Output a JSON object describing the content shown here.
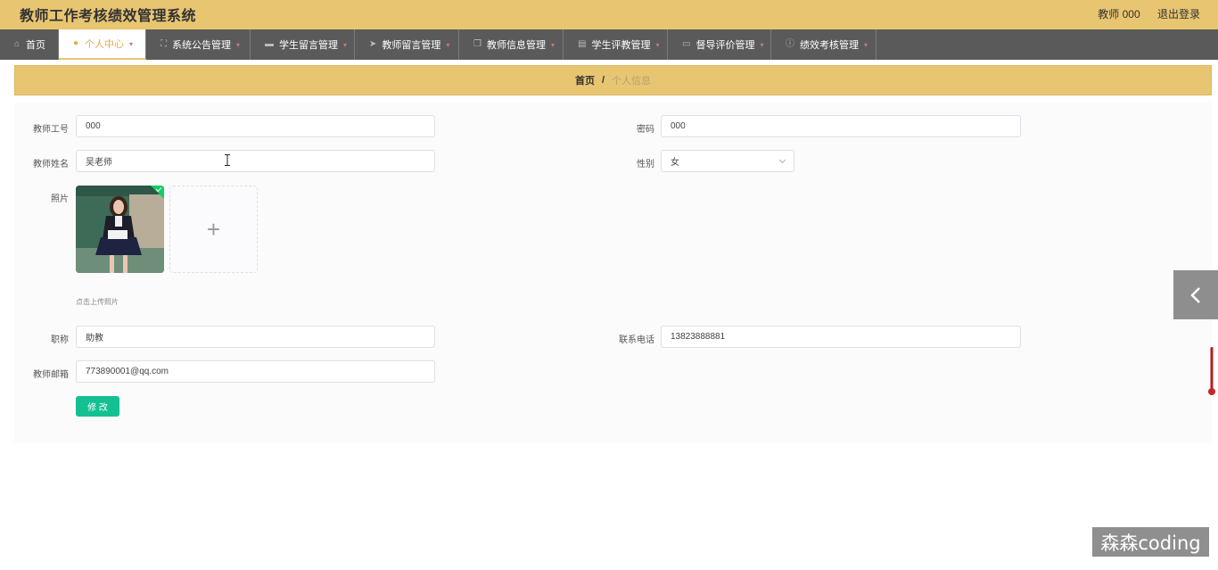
{
  "header": {
    "title": "教师工作考核绩效管理系统",
    "user_label": "教师 000",
    "logout_label": "退出登录"
  },
  "nav": {
    "items": [
      {
        "label": "首页",
        "icon": "home-icon"
      },
      {
        "label": "个人中心",
        "icon": "user-icon"
      },
      {
        "label": "系统公告管理",
        "icon": "expand-icon"
      },
      {
        "label": "学生留言管理",
        "icon": "bag-icon"
      },
      {
        "label": "教师留言管理",
        "icon": "send-icon"
      },
      {
        "label": "教师信息管理",
        "icon": "copy-icon"
      },
      {
        "label": "学生评教管理",
        "icon": "document-icon"
      },
      {
        "label": "督导评价管理",
        "icon": "monitor-icon"
      },
      {
        "label": "绩效考核管理",
        "icon": "info-circle-icon"
      }
    ]
  },
  "breadcrumb": {
    "home": "首页",
    "separator": "/",
    "current": "个人信息"
  },
  "form": {
    "teacher_id_label": "教师工号",
    "teacher_id_value": "000",
    "password_label": "密码",
    "password_value": "000",
    "name_label": "教师姓名",
    "name_value": "吴老师",
    "gender_label": "性别",
    "gender_value": "女",
    "photo_label": "照片",
    "upload_hint": "点击上传照片",
    "title_label": "职称",
    "title_value": "助教",
    "phone_label": "联系电话",
    "phone_value": "13823888881",
    "email_label": "教师邮箱",
    "email_value": "773890001@qq.com",
    "submit_label": "修 改"
  },
  "watermark": "森森coding",
  "colors": {
    "header_bg": "#e8c571",
    "nav_bg": "#5a5a5a",
    "active_text": "#e8a94a",
    "submit_bg": "#13c091"
  }
}
